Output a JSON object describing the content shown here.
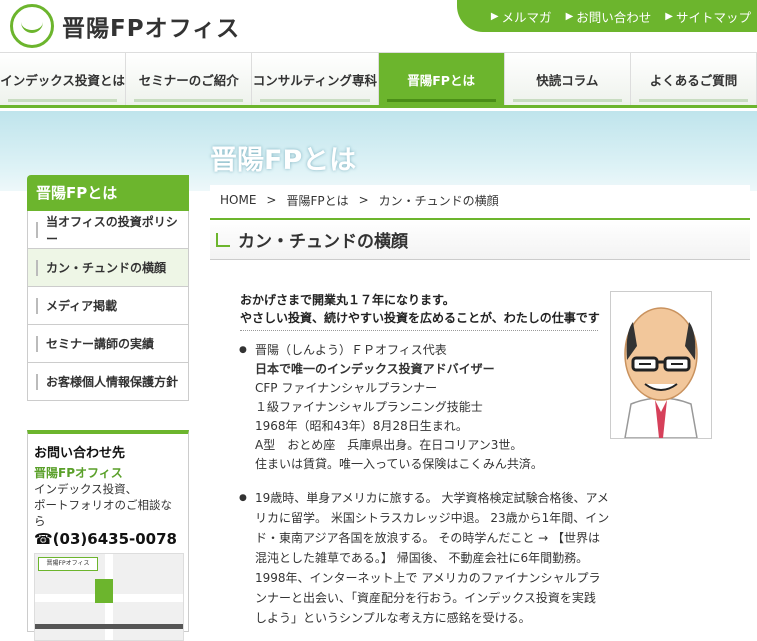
{
  "header": {
    "logo_text": "晋陽FPオフィス",
    "links": [
      {
        "label": "メルマガ"
      },
      {
        "label": "お問い合わせ"
      },
      {
        "label": "サイトマップ"
      }
    ]
  },
  "nav": {
    "items": [
      {
        "label": "インデックス投資とは"
      },
      {
        "label": "セミナーのご紹介"
      },
      {
        "label": "コンサルティング専科"
      },
      {
        "label": "晋陽FPとは"
      },
      {
        "label": "快読コラム"
      },
      {
        "label": "よくあるご質問"
      }
    ]
  },
  "page": {
    "title": "晋陽FPとは"
  },
  "breadcrumb": {
    "home": "HOME",
    "sep1": ">",
    "level1": "晋陽FPとは",
    "sep2": ">",
    "current": "カン・チュンドの横顔"
  },
  "section": {
    "title": "カン・チュンドの横顔"
  },
  "sidebar": {
    "heading": "晋陽FPとは",
    "items": [
      {
        "label": "当オフィスの投資ポリシー"
      },
      {
        "label": "カン・チュンドの横顔"
      },
      {
        "label": "メディア掲載"
      },
      {
        "label": "セミナー講師の実績"
      },
      {
        "label": "お客様個人情報保護方針"
      }
    ]
  },
  "contact": {
    "title": "お問い合わせ先",
    "name": "晋陽FPオフィス",
    "desc1": "インデックス投資、",
    "desc2": "ポートフォリオのご相談なら",
    "tel": "☎(03)6435-0078",
    "map_logo": "晋陽FPオフィス"
  },
  "intro": {
    "line1": "おかげさまで開業丸１７年になります。",
    "line2": "やさしい投資、続けやすい投資を広めることが、わたしの仕事です"
  },
  "profile": {
    "lines": [
      "晋陽（しんよう）ＦＰオフィス代表",
      "日本で唯一のインデックス投資アドバイザー",
      "CFP ファイナンシャルプランナー",
      "１級ファイナンシャルプランニング技能士",
      "1968年（昭和43年）8月28日生まれ。",
      "A型　おとめ座　兵庫県出身。在日コリアン3世。",
      "住まいは賃貸。唯一入っている保険はこくみん共済。"
    ]
  },
  "bio": {
    "lines": [
      "19歳時、単身アメリカに旅する。 大学資格検定試験合格後、アメ",
      "リカに留学。 米国シトラスカレッジ中退。 23歳から1年間、イン",
      "ド・東南アジア各国を放浪する。 その時学んだこと → 【世界は",
      "混沌とした雑草である。】 帰国後、 不動産会社に6年間勤務。",
      "1998年、インターネット上で アメリカのファイナンシャルプラ",
      "ンナーと出会い、「資産配分を行おう。インデックス投資を実践",
      "しよう」というシンプルな考え方に感銘を受ける。"
    ]
  },
  "colors": {
    "accent": "#6cb52d",
    "banner": "#cfeaf0"
  },
  "icons": {
    "logo": "logo-mark",
    "arrow": "chevron-right-icon",
    "section": "corner-arrow-icon",
    "bullet": "bullet-icon"
  }
}
